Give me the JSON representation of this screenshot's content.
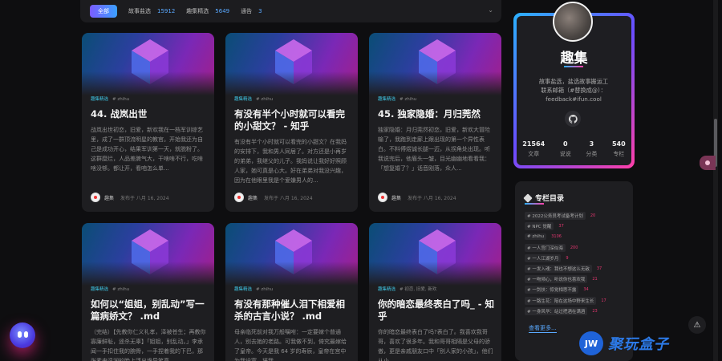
{
  "filter": {
    "all_label": "全部",
    "items": [
      {
        "label": "故事盐选",
        "count": "15912"
      },
      {
        "label": "趣集精选",
        "count": "5649"
      },
      {
        "label": "通告",
        "count": "3"
      }
    ]
  },
  "cards": [
    {
      "category": "趣集精选",
      "tags": "# zhihu",
      "title": "44. 战岚出世",
      "excerpt": "战岚出世初恋，旧爱，新欢我在一档军训综艺里，成了一群顶流明星的教官。开始我还为自己是成功开心，结果军训第一天，就脱粉了。这群糜烂，人品差脾气大，干啥啥不行，吃啥啥没够。都让开，看咱怎么单...",
      "author": "趣集",
      "date": "发布于 八月 16, 2024"
    },
    {
      "category": "趣集精选",
      "tags": "# zhihu",
      "title": "有没有半个小时就可以看完的小甜文？ - 知乎",
      "excerpt": "有没有半个小时就可以看完的小甜文？在我妈的安排下，我和男人同居了。对方还是小再岁的弟弟，我继父的儿子。我妈说让我好好照顾人家，她可真是心大。好在弟弟对我没兴趣，因为在他眼里我是个爱嫌男人的...",
      "author": "趣集",
      "date": "发布于 八月 16, 2024"
    },
    {
      "category": "趣集精选",
      "tags": "# zhihu",
      "title": "45. 独家隐婚：月归莞然",
      "excerpt": "独家隐婚：月归莞然初恋，旧爱，新欢大冒险输了，我跑到走廊上跟出现的第一个异性表白。不料傅煜诚长腿一迈，从拐角处出现。听我说完后，他眉头一皱，目光幽幽地看看我：「想复婚了？」话音刚落，众人...",
      "author": "趣集",
      "date": "发布于 八月 16, 2024"
    },
    {
      "category": "趣集精选",
      "tags": "# zhihu",
      "title": "如何以“姐姐，别乱动”写一篇病娇文？ .md",
      "excerpt": "（完结）【先教你仁义礼孝，泽被苍生；再教你寡廉鲜耻，遥杀无辜】「姐姐，别乱动。」李承闻一手扣住我的腕骨，一手捏着我的下巴，那张素来温润的脸上浮出诡异笑意...",
      "author": "趣集",
      "date": "发布于 八月 16, 2024"
    },
    {
      "category": "趣集精选",
      "tags": "# zhihu",
      "title": "有没有那种催人泪下相爱相杀的古言小说？ .md",
      "excerpt": "母亲临死前对我万般嘱咐：一定要嫁个普通人，别去她的老路。可我做不到，倚究最嫁给了皇帝。今天是我 64 岁的寿辰，皇帝在宫中为我设宴，将我...",
      "author": "趣集",
      "date": "发布于 八月 16, 2024"
    },
    {
      "category": "趣集精选",
      "tags": "# 初恋, 旧爱, 新欢",
      "title": "你的暗恋最终表白了吗_ - 知乎",
      "excerpt": "你的暗恋最终表白了吗?表白了。我喜欢我哥哥，喜欢了很多年。我和哥哥相隔是父母的骄傲，更是亲戚朋友口中「别人家的小孩」，他们从小...",
      "author": "趣集",
      "date": "发布于 八月 16, 2024"
    }
  ],
  "profile": {
    "name": "趣集",
    "desc_line1": "故事盐选，盐选故事搬运工",
    "desc_line2": "联系邮箱（#替换成@）：",
    "desc_line3": "feedback#ifun.cool",
    "stats": [
      {
        "n": "21564",
        "l": "文章"
      },
      {
        "n": "0",
        "l": "说说"
      },
      {
        "n": "3",
        "l": "分类"
      },
      {
        "n": "540",
        "l": "专栏"
      }
    ]
  },
  "columns": {
    "title": "专栏目录",
    "items": [
      {
        "name": "# 2022公务员考试备考计划",
        "count": "20"
      },
      {
        "name": "# NPC 觉醒",
        "count": "37"
      },
      {
        "name": "# zhihu",
        "count": "3106"
      },
      {
        "name": "# 一人宫门深似海",
        "count": "200"
      },
      {
        "name": "# 一人江湖岁月",
        "count": "9"
      },
      {
        "name": "# 一发入魂：我也不想这么无敌",
        "count": "37"
      },
      {
        "name": "# 一吻倾心，听说你也喜欢我",
        "count": "21"
      },
      {
        "name": "# 一剑扶：惊觉相思不露",
        "count": "34"
      },
      {
        "name": "# 一路生花：陪在这场中野来生长",
        "count": "17"
      },
      {
        "name": "# 一身风华：站过把酒在满酒",
        "count": "23"
      }
    ],
    "more_label": "查看更多..."
  },
  "watermark": {
    "logo": "JW",
    "text": "聚玩盒子"
  }
}
